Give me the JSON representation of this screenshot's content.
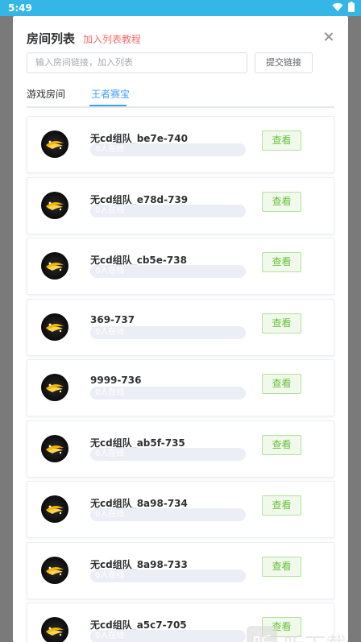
{
  "status": {
    "time": "5:49"
  },
  "dialog": {
    "title": "房间列表",
    "tutorial_link": "加入列表教程",
    "input_placeholder": "输入房间链接，加入列表",
    "submit_label": "提交链接",
    "tabs": [
      {
        "label": "游戏房间",
        "active": false
      },
      {
        "label": "王者赛宝",
        "active": true
      }
    ]
  },
  "rooms": [
    {
      "name": "无cd组队_be7e-740",
      "online": "0人在线",
      "action": "查看"
    },
    {
      "name": "无cd组队_e78d-739",
      "online": "0人在线",
      "action": "查看"
    },
    {
      "name": "无cd组队_cb5e-738",
      "online": "0人在线",
      "action": "查看"
    },
    {
      "name": "369-737",
      "online": "0人在线",
      "action": "查看"
    },
    {
      "name": "9999-736",
      "online": "0人在线",
      "action": "查看"
    },
    {
      "name": "无cd组队_ab5f-735",
      "online": "0人在线",
      "action": "查看"
    },
    {
      "name": "无cd组队_8a98-734",
      "online": "0人在线",
      "action": "查看"
    },
    {
      "name": "无cd组队_8a98-733",
      "online": "0人在线",
      "action": "查看"
    },
    {
      "name": "无cd组队_a5c7-705",
      "online": "0人在线",
      "action": "查看"
    }
  ],
  "watermark": {
    "icon_char": "听",
    "text": "听下载"
  },
  "colors": {
    "statusbar": "#34b6e6",
    "accent": "#409eff",
    "danger": "#f56c6c",
    "success": "#67c23a"
  }
}
